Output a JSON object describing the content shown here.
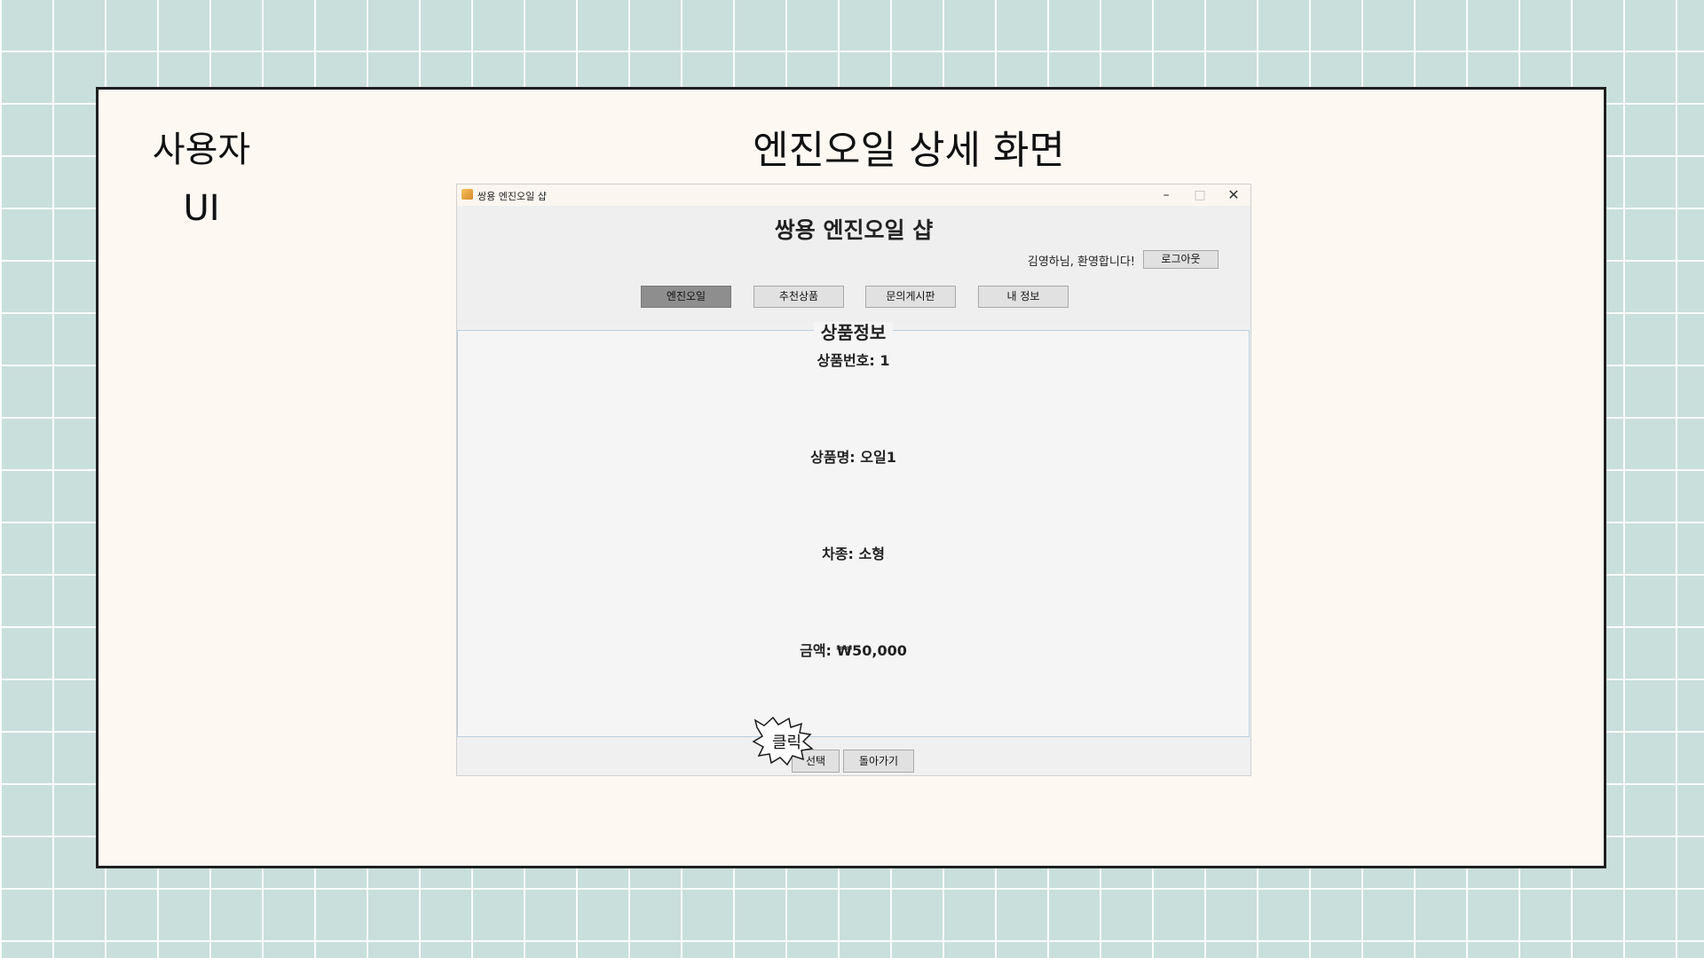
{
  "slide": {
    "label": "사용자\nUI",
    "title": "엔진오일 상세 화면"
  },
  "window": {
    "title": "쌍용 엔진오일 샵",
    "controls": {
      "minimize": "–",
      "maximize": "□",
      "close": "✕"
    }
  },
  "app": {
    "shop_title": "쌍용 엔진오일 샵",
    "welcome": "김영하님, 환영합니다!",
    "logout_label": "로그아웃",
    "nav": [
      "엔진오일",
      "추천상품",
      "문의게시판",
      "내 정보"
    ],
    "active_nav": "엔진오일"
  },
  "detail": {
    "section_title": "상품정보",
    "product_no": "상품번호: 1",
    "product_name": "상품명: 오일1",
    "car_type": "차종: 소형",
    "price": "금액: ₩50,000"
  },
  "actions": {
    "select_label": "선택",
    "back_label": "돌아가기"
  },
  "annotation": {
    "callout_text": "클릭"
  }
}
